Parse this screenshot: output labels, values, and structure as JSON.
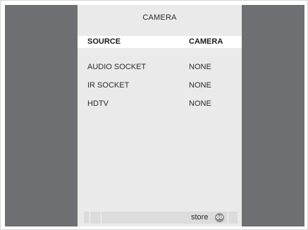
{
  "menu": {
    "title": "CAMERA",
    "rows": [
      {
        "label": "SOURCE",
        "value": "CAMERA",
        "selected": true
      },
      {
        "label": "AUDIO SOCKET",
        "value": "NONE",
        "selected": false
      },
      {
        "label": "IR SOCKET",
        "value": "NONE",
        "selected": false
      },
      {
        "label": "HDTV",
        "value": "NONE",
        "selected": false
      }
    ]
  },
  "status_bar": {
    "store_label": "store",
    "go_icon_text": "GO",
    "go_icon": "go-button-icon"
  },
  "colors": {
    "screen_background": "#6e6f72",
    "menu_background": "#eaeaeb",
    "selected_row": "#ffffff",
    "status_bar": "#dcdcdd"
  }
}
